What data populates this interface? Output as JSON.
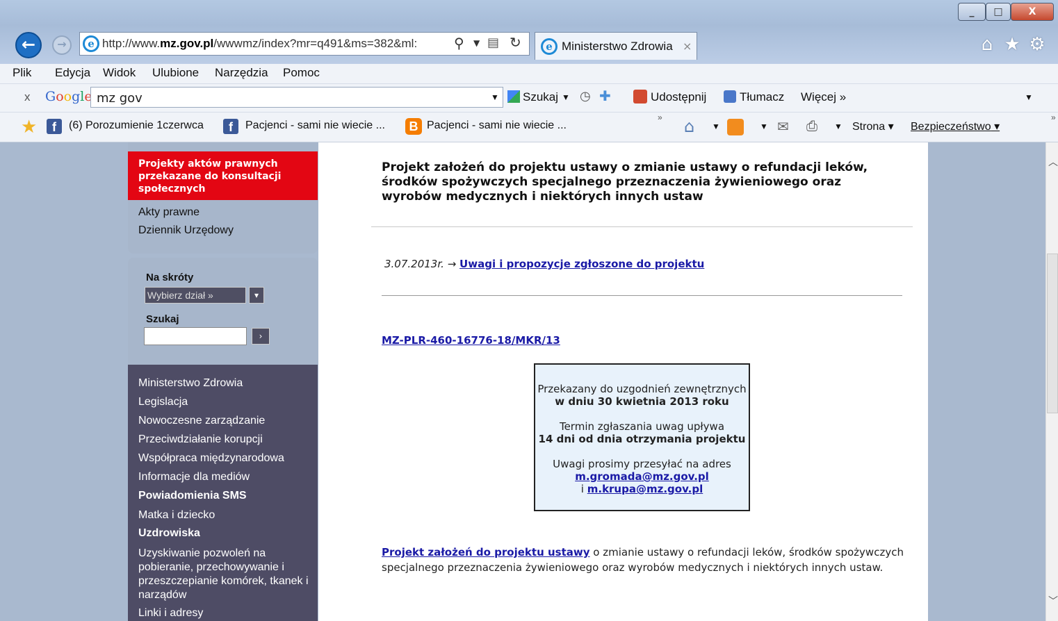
{
  "browser": {
    "url_plain": "http://www.",
    "url_bold": "mz.gov.pl",
    "url_rest": "/wwwmz/index?mr=q491&ms=382&ml:",
    "tab_title": "Ministerstwo Zdrowia",
    "tab_close": "×",
    "menu": [
      "Plik",
      "Edycja",
      "Widok",
      "Ulubione",
      "Narzędzia",
      "Pomoc"
    ],
    "google_label": "Google",
    "google_query": "mz gov",
    "google_close": "x",
    "google_tools": {
      "search": "Szukaj",
      "share": "Udostępnij",
      "translate": "Tłumacz",
      "more": "Więcej »"
    },
    "favorites": [
      "(6) Porozumienie 1czerwca",
      "Pacjenci - sami nie wiecie ...",
      "Pacjenci - sami nie wiecie ..."
    ],
    "command_bar": {
      "page": "Strona",
      "safety": "Bezpieczeństwo"
    },
    "window_buttons": {
      "minimize": "_",
      "maximize": "□",
      "close": "X"
    }
  },
  "sidebar": {
    "active_item": "Projekty aktów prawnych przekazane do konsultacji społecznych",
    "top_links": [
      "Akty prawne",
      "Dziennik Urzędowy"
    ],
    "shortcuts_label": "Na skróty",
    "select_placeholder": "Wybierz dział »",
    "search_label": "Szukaj",
    "search_value": "",
    "nav_links": [
      {
        "label": "Ministerstwo Zdrowia",
        "bold": false
      },
      {
        "label": "Legislacja",
        "bold": false
      },
      {
        "label": "Nowoczesne zarządzanie",
        "bold": false
      },
      {
        "label": "Przeciwdziałanie korupcji",
        "bold": false
      },
      {
        "label": "Współpraca międzynarodowa",
        "bold": false
      },
      {
        "label": "Informacje dla mediów",
        "bold": false
      },
      {
        "label": "Powiadomienia SMS",
        "bold": true
      },
      {
        "label": "Matka i dziecko",
        "bold": false
      },
      {
        "label": "Uzdrowiska",
        "bold": true
      },
      {
        "label": "Uzyskiwanie pozwoleń na pobieranie, przechowywanie i przeszczepianie komórek, tkanek i narządów",
        "bold": false
      },
      {
        "label": "Linki i adresy",
        "bold": false
      }
    ]
  },
  "content": {
    "title": "Projekt założeń do projektu ustawy o zmianie ustawy o refundacji leków, środków spożywczych specjalnego przeznaczenia żywieniowego oraz wyrobów medycznych i niektórych innych ustaw",
    "date": "3.07.2013r.",
    "arrow": "→",
    "comments_link": "Uwagi i propozycje zgłoszone do projektu",
    "reference_link": "MZ-PLR-460-16776-18/MKR/13",
    "infobox": {
      "line1": "Przekazany do uzgodnień zewnętrznych",
      "line2": "w dniu 30 kwietnia 2013 roku",
      "line3": "Termin zgłaszania uwag upływa",
      "line4": "14 dni od dnia otrzymania projektu",
      "line5": "Uwagi prosimy przesyłać na adres",
      "email1": "m.gromada@mz.gov.pl",
      "and": "i",
      "email2": "m.krupa@mz.gov.pl"
    },
    "paragraph_link": "Projekt założeń do projektu ustawy",
    "paragraph_rest": " o zmianie ustawy o refundacji leków, środków spożywczych specjalnego przeznaczenia żywieniowego oraz wyrobów medycznych i niektórych innych ustaw."
  },
  "colors": {
    "accent_red": "#e30613",
    "sidebar_dark": "#4e4c65",
    "sidebar_light": "#a7b6cb",
    "link": "#1a1aa6"
  }
}
